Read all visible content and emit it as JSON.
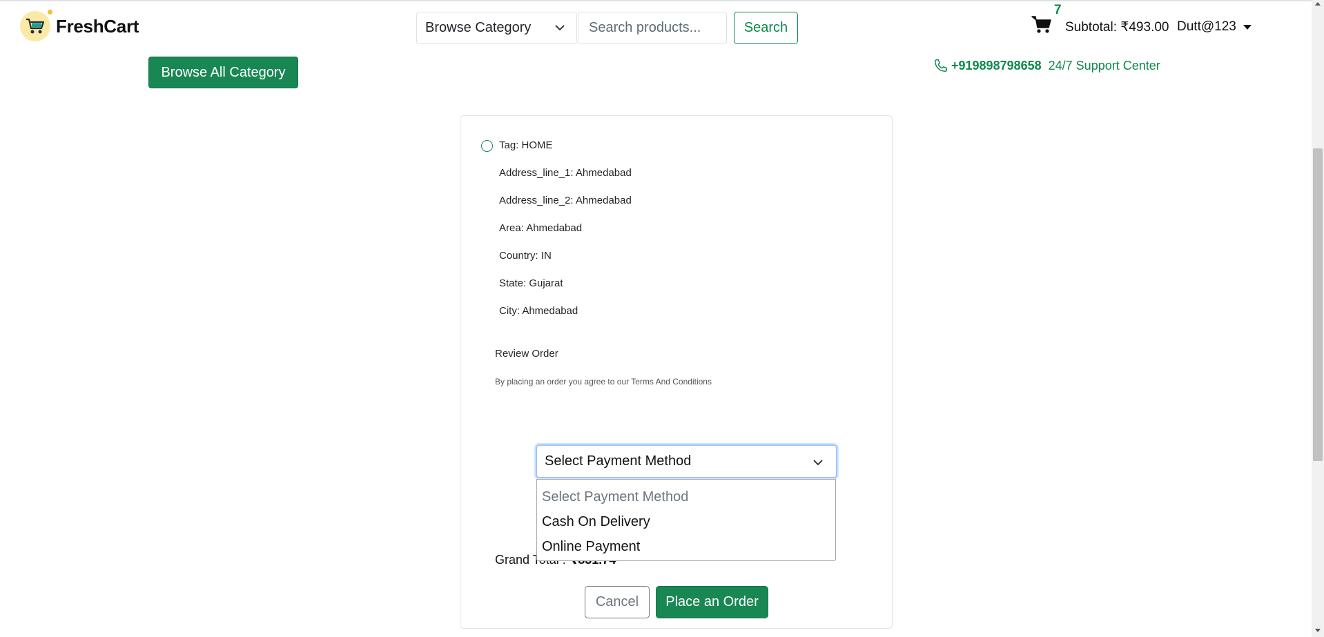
{
  "header": {
    "logo_text": "FreshCart",
    "category_select_label": "Browse Category",
    "search_placeholder": "Search products...",
    "search_button": "Search",
    "cart_count": "7",
    "subtotal": "Subtotal: ₹493.00",
    "username": "Dutt@123"
  },
  "nav": {
    "browse_all": "Browse All Category",
    "support_phone": "+919898798658",
    "support_text": "24/7 Support Center"
  },
  "address": {
    "tag": "Tag: HOME",
    "lines": [
      "Address_line_1: Ahmedabad",
      "Address_line_2: Ahmedabad",
      "Area: Ahmedabad",
      "Country: IN",
      "State: Gujarat",
      "City: Ahmedabad"
    ]
  },
  "review": {
    "title": "Review Order",
    "terms": "By placing an order you agree to our Terms And Conditions"
  },
  "payment": {
    "selected": "Select Payment Method",
    "options": [
      "Select Payment Method",
      "Cash On Delivery",
      "Online Payment"
    ]
  },
  "totals": {
    "grand_label": "Grand Total :",
    "grand_value": "₹831.74"
  },
  "actions": {
    "cancel": "Cancel",
    "place_order": "Place an Order"
  },
  "colors": {
    "brand_green": "#198754",
    "text_green": "#0a8a4a",
    "focus_border": "#9ec5fe"
  },
  "icons": {
    "logo": "shopping-cart-logo-icon",
    "cart": "cart-icon",
    "phone": "phone-icon",
    "chevron": "chevron-down-icon"
  }
}
